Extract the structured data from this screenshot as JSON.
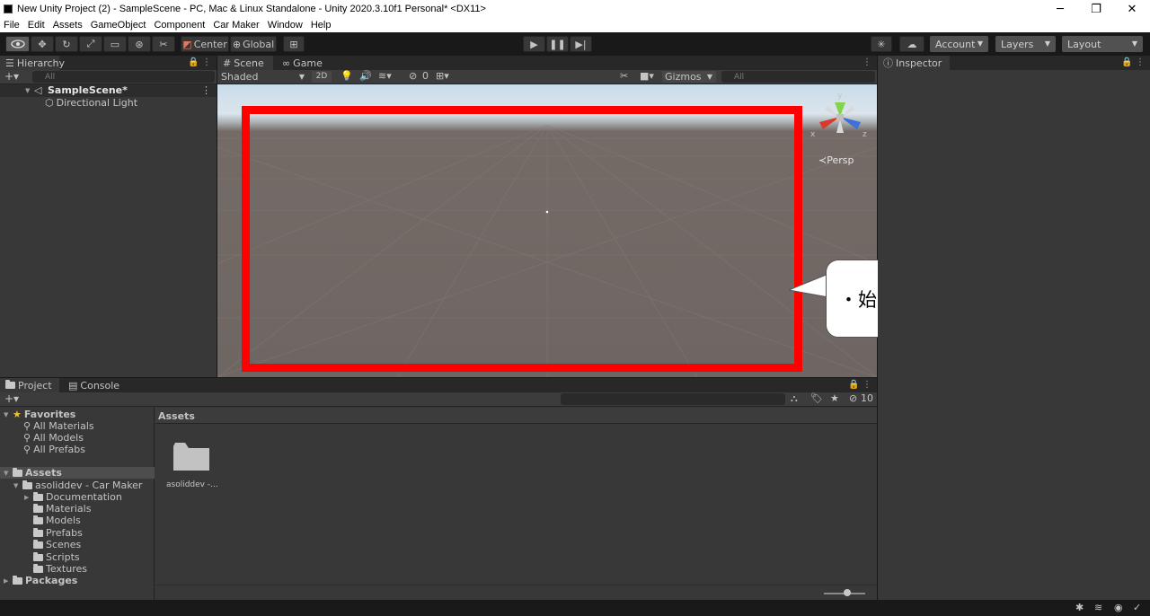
{
  "window": {
    "title": "New Unity Project (2) - SampleScene - PC, Mac & Linux Standalone - Unity 2020.3.10f1 Personal* <DX11>",
    "controls": [
      "─",
      "❐",
      "✕"
    ]
  },
  "menu": [
    "File",
    "Edit",
    "Assets",
    "GameObject",
    "Component",
    "Car Maker",
    "Window",
    "Help"
  ],
  "toolbar": {
    "pivot": "Center",
    "space": "Global",
    "account": "Account",
    "layers": "Layers",
    "layout": "Layout"
  },
  "hierarchy": {
    "tab": "Hierarchy",
    "search_placeholder": "All",
    "scene": "SampleScene*",
    "items": [
      "Directional Light"
    ]
  },
  "scene_view": {
    "tabs": [
      "Scene",
      "Game"
    ],
    "shading": "Shaded",
    "mode_2d": "2D",
    "hidden_count": "0",
    "gizmos": "Gizmos",
    "search_placeholder": "All",
    "persp": "≺Persp",
    "axes": {
      "x": "x",
      "y": "y",
      "z": "z"
    }
  },
  "inspector": {
    "tab": "Inspector"
  },
  "project": {
    "tabs": [
      "Project",
      "Console"
    ],
    "hidden_count": "10",
    "favorites_label": "Favorites",
    "favorites": [
      "All Materials",
      "All Models",
      "All Prefabs"
    ],
    "assets_label": "Assets",
    "package_folder": "asoliddev - Car Maker",
    "subfolders": [
      "Documentation",
      "Materials",
      "Models",
      "Prefabs",
      "Scenes",
      "Scripts",
      "Textures"
    ],
    "packages_label": "Packages",
    "breadcrumb": "Assets",
    "grid_items": [
      "asoliddev -..."
    ]
  },
  "callout": {
    "text": "・始めに何もない場合"
  },
  "colors": {
    "highlight": "#ff0000",
    "panel": "#383838",
    "background": "#191919"
  }
}
